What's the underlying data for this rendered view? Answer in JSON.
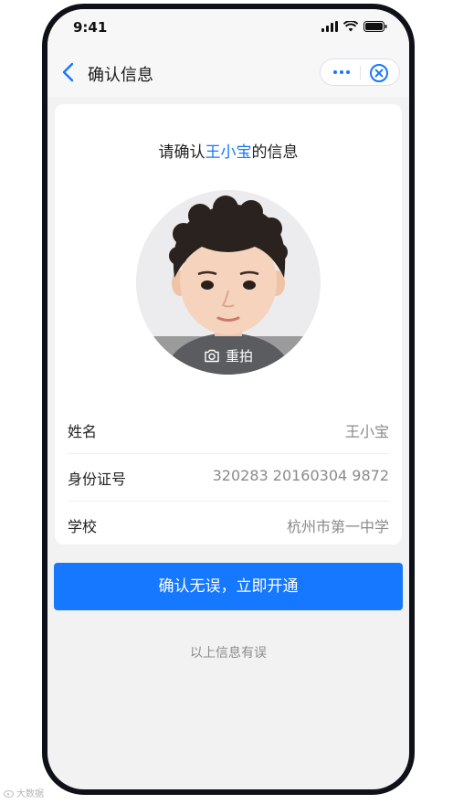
{
  "status_bar": {
    "time": "9:41"
  },
  "nav": {
    "title": "确认信息",
    "more_icon": "more-dots-icon",
    "close_icon": "close-circle-icon"
  },
  "card": {
    "heading_prefix": "请确认",
    "heading_name": "王小宝",
    "heading_suffix": "的信息",
    "retake_label": "重拍",
    "fields": [
      {
        "label": "姓名",
        "value": "王小宝"
      },
      {
        "label": "身份证号",
        "value": "320283 20160304 9872"
      },
      {
        "label": "学校",
        "value": "杭州市第一中学"
      }
    ]
  },
  "actions": {
    "confirm_label": "确认无误，立即开通",
    "error_link": "以上信息有误"
  },
  "watermark": "大数据",
  "colors": {
    "accent": "#1677ff",
    "background": "#f2f2f3",
    "frame": "#0e1117"
  }
}
